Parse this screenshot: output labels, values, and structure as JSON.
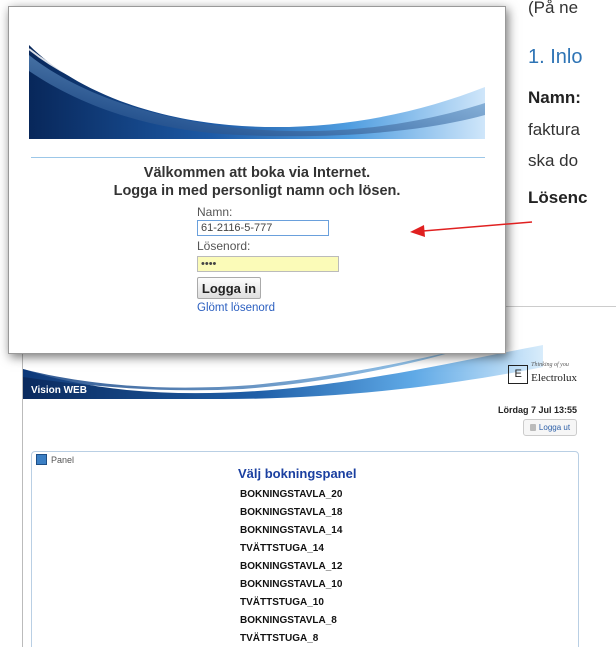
{
  "document": {
    "paren_text": "(På ne",
    "heading": "1. Inlo",
    "namn_label": "Namn:",
    "line1": "faktura",
    "line2": "ska do",
    "losen_label": "Lösenc"
  },
  "login": {
    "welcome_line1": "Välkommen att boka via Internet.",
    "welcome_line2": "Logga in med personligt namn och lösen.",
    "name_label": "Namn:",
    "name_value": "61-2116-5-777",
    "password_label": "Lösenord:",
    "password_value": "••••",
    "login_button": "Logga in",
    "forgot_link": "Glömt lösenord"
  },
  "booking": {
    "app_name": "Vision WEB",
    "brand_name": "Electrolux",
    "brand_tagline": "Thinking of you",
    "datetime": "Lördag 7 Jul 13:55",
    "logout_label": "Logga ut",
    "panel_label": "Panel",
    "panel_title": "Välj bokningspanel",
    "panels": [
      "BOKNINGSTAVLA_20",
      "BOKNINGSTAVLA_18",
      "BOKNINGSTAVLA_14",
      "TVÄTTSTUGA_14",
      "BOKNINGSTAVLA_12",
      "BOKNINGSTAVLA_10",
      "TVÄTTSTUGA_10",
      "BOKNINGSTAVLA_8",
      "TVÄTTSTUGA_8"
    ]
  },
  "colors": {
    "heading_blue": "#2e74b5",
    "arrow_red": "#e02020",
    "panel_title_blue": "#1a3fa0",
    "password_bg": "#fbfbb8"
  }
}
